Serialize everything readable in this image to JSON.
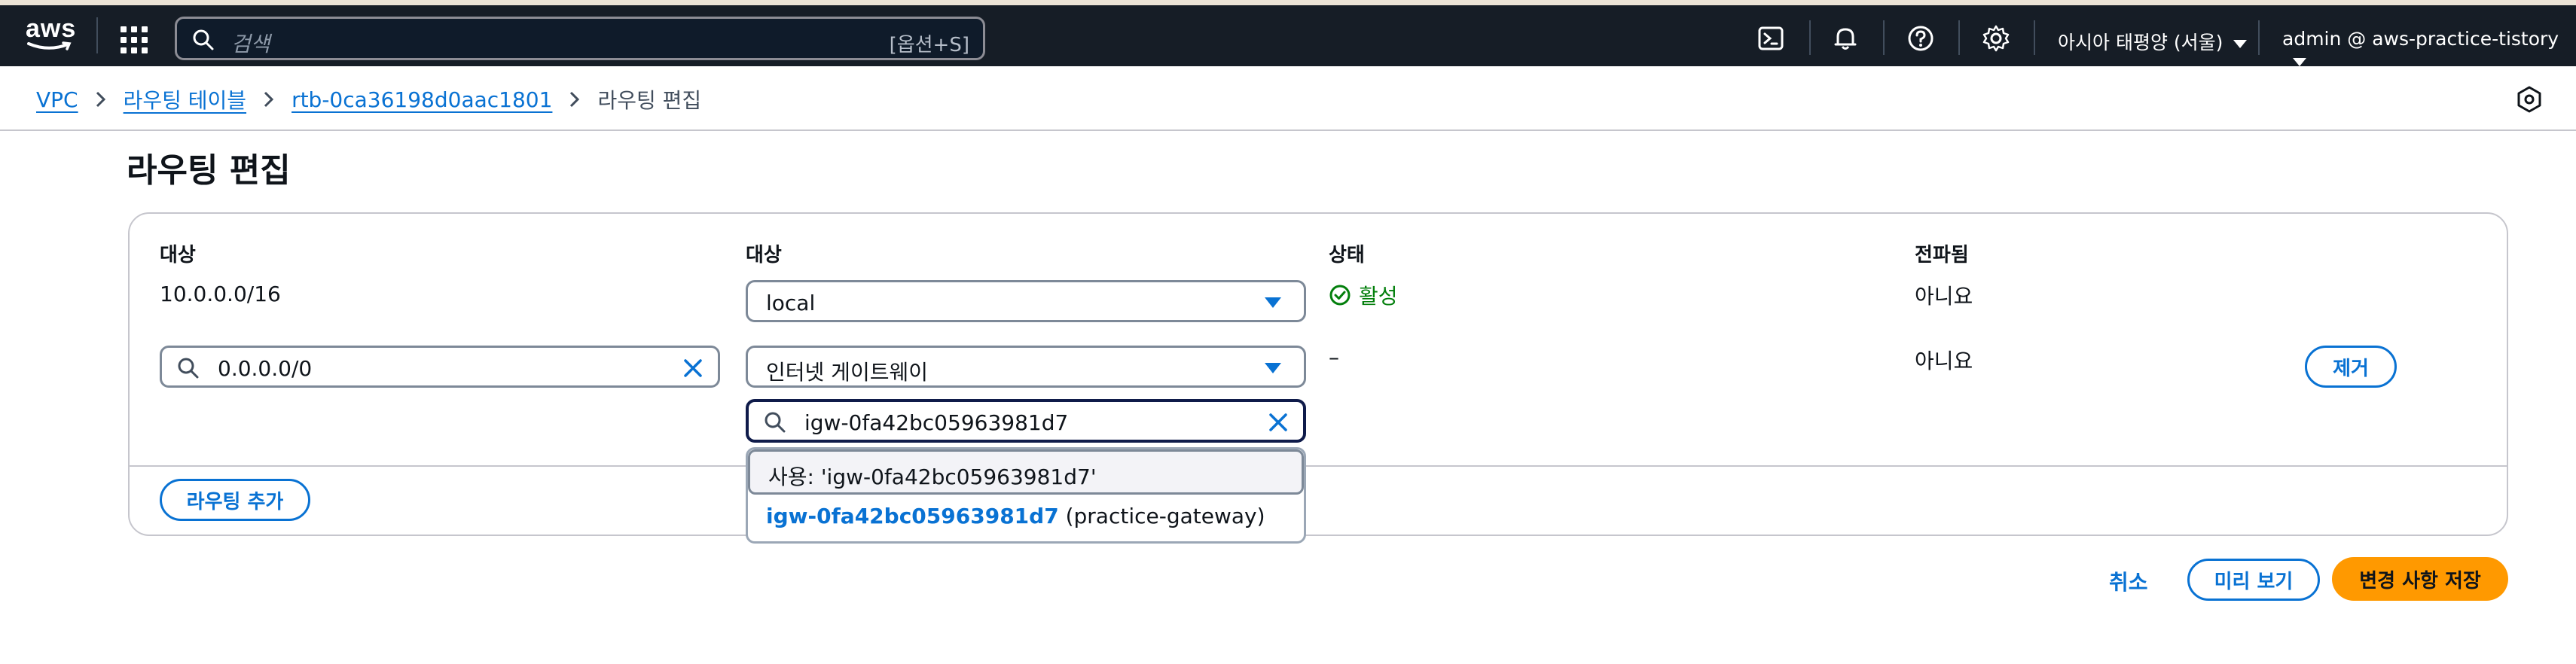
{
  "topnav": {
    "logo_text": "aws",
    "search_placeholder": "검색",
    "search_shortcut": "[옵션+S]",
    "icons": [
      "services-grid-icon",
      "cloudshell-icon",
      "bell-icon",
      "help-icon",
      "gear-icon"
    ],
    "region": "아시아 태평양 (서울)",
    "account": "admin @ aws-practice-tistory"
  },
  "breadcrumb": {
    "items": [
      "VPC",
      "라우팅 테이블",
      "rtb-0ca36198d0aac1801"
    ],
    "current": "라우팅 편집"
  },
  "page": {
    "title": "라우팅 편집"
  },
  "table": {
    "headers": {
      "destination": "대상",
      "target": "대상",
      "status": "상태",
      "propagated": "전파됨"
    },
    "rows": [
      {
        "destination": "10.0.0.0/16",
        "target": "local",
        "status": "활성",
        "propagated": "아니요"
      },
      {
        "destination": "0.0.0.0/0",
        "target": "인터넷 게이트웨이",
        "target_search": "igw-0fa42bc05963981d7",
        "status": "–",
        "propagated": "아니요",
        "remove_label": "제거"
      }
    ],
    "add_route_label": "라우팅 추가"
  },
  "dropdown": {
    "use_option": "사용: 'igw-0fa42bc05963981d7'",
    "option_id": "igw-0fa42bc05963981d7",
    "option_name": "(practice-gateway)"
  },
  "actions": {
    "cancel": "취소",
    "preview": "미리 보기",
    "save": "변경 사항 저장"
  },
  "colors": {
    "nav_bg": "#161d26",
    "link": "#0972d3",
    "success": "#037f0c",
    "primary": "#ff9900"
  }
}
